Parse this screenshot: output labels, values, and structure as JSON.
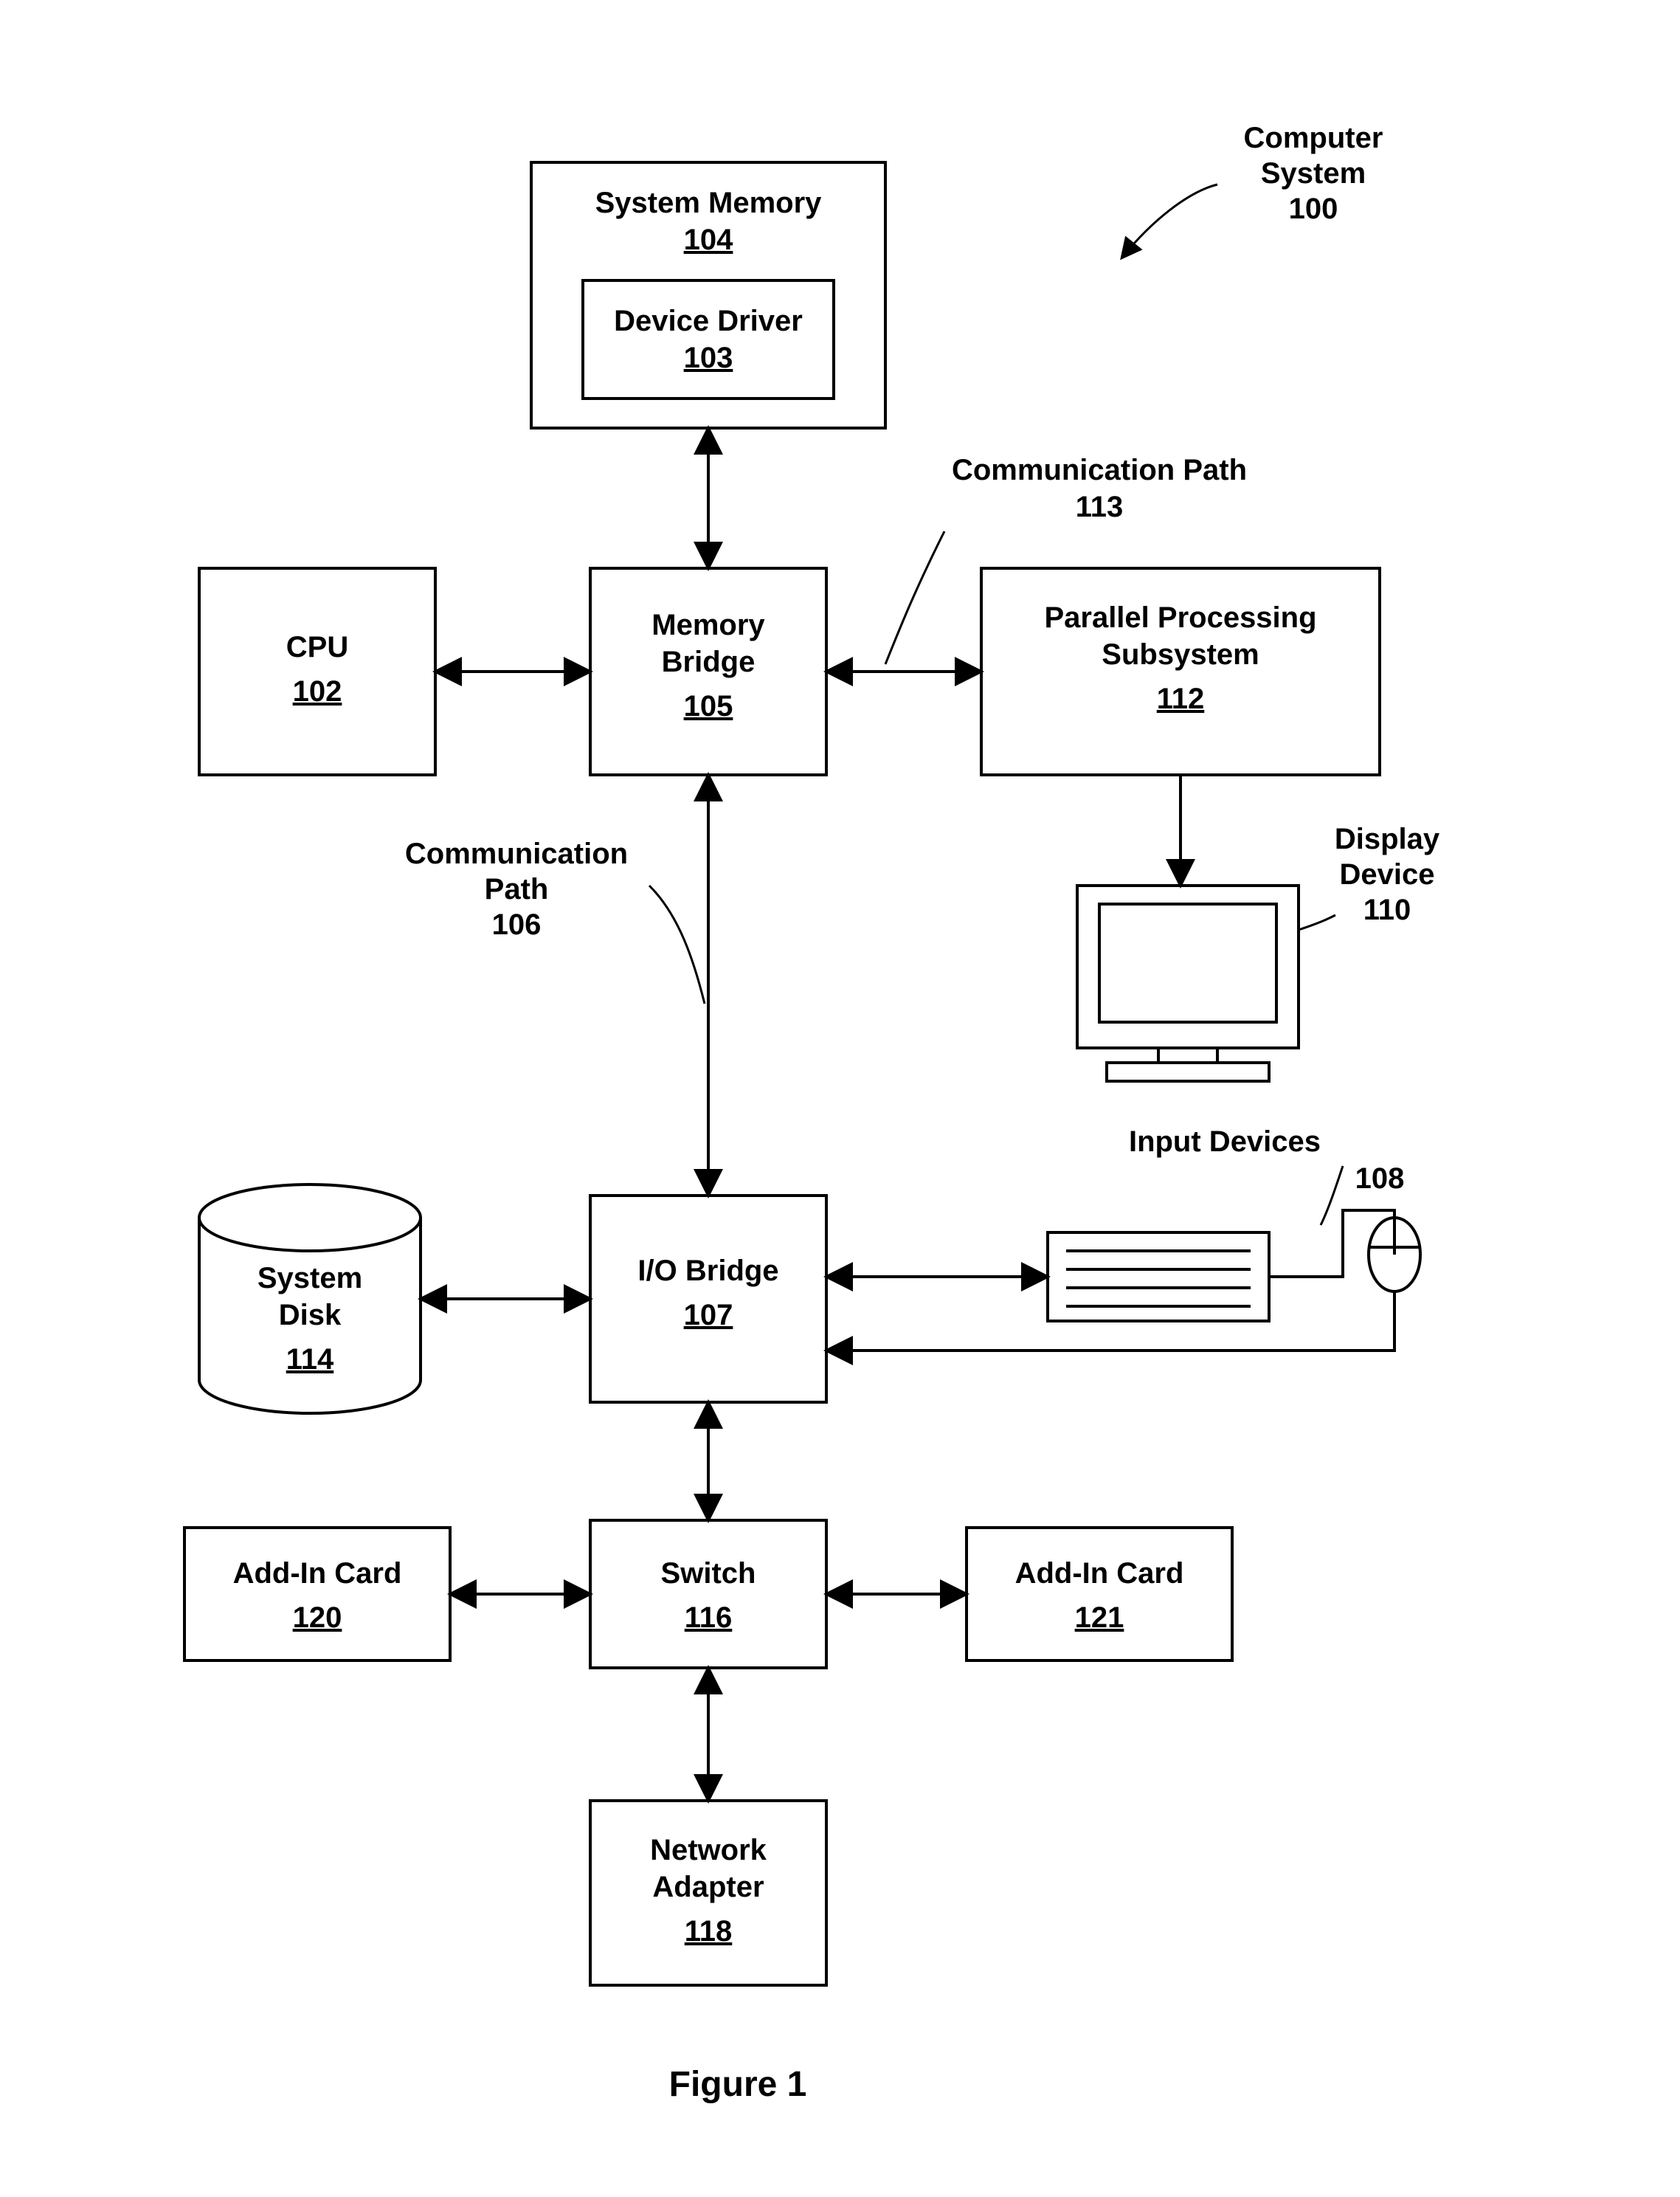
{
  "figure": {
    "caption": "Figure 1"
  },
  "overall": {
    "label_l1": "Computer",
    "label_l2": "System",
    "ref": "100"
  },
  "sysmem": {
    "title": "System Memory",
    "ref": "104"
  },
  "driver": {
    "title": "Device Driver",
    "ref": "103"
  },
  "cpu": {
    "title": "CPU",
    "ref": "102"
  },
  "membridge": {
    "title_l1": "Memory",
    "title_l2": "Bridge",
    "ref": "105"
  },
  "comm113": {
    "label": "Communication Path",
    "ref": "113"
  },
  "pps": {
    "title_l1": "Parallel Processing",
    "title_l2": "Subsystem",
    "ref": "112"
  },
  "display": {
    "label_l1": "Display",
    "label_l2": "Device",
    "ref": "110"
  },
  "comm106": {
    "label_l1": "Communication",
    "label_l2": "Path",
    "ref": "106"
  },
  "sysdisk": {
    "title_l1": "System",
    "title_l2": "Disk",
    "ref": "114"
  },
  "iobridge": {
    "title": "I/O Bridge",
    "ref": "107"
  },
  "inputdev": {
    "label": "Input Devices",
    "ref": "108"
  },
  "switch": {
    "title": "Switch",
    "ref": "116"
  },
  "cardL": {
    "title": "Add-In Card",
    "ref": "120"
  },
  "cardR": {
    "title": "Add-In Card",
    "ref": "121"
  },
  "netadp": {
    "title_l1": "Network",
    "title_l2": "Adapter",
    "ref": "118"
  }
}
